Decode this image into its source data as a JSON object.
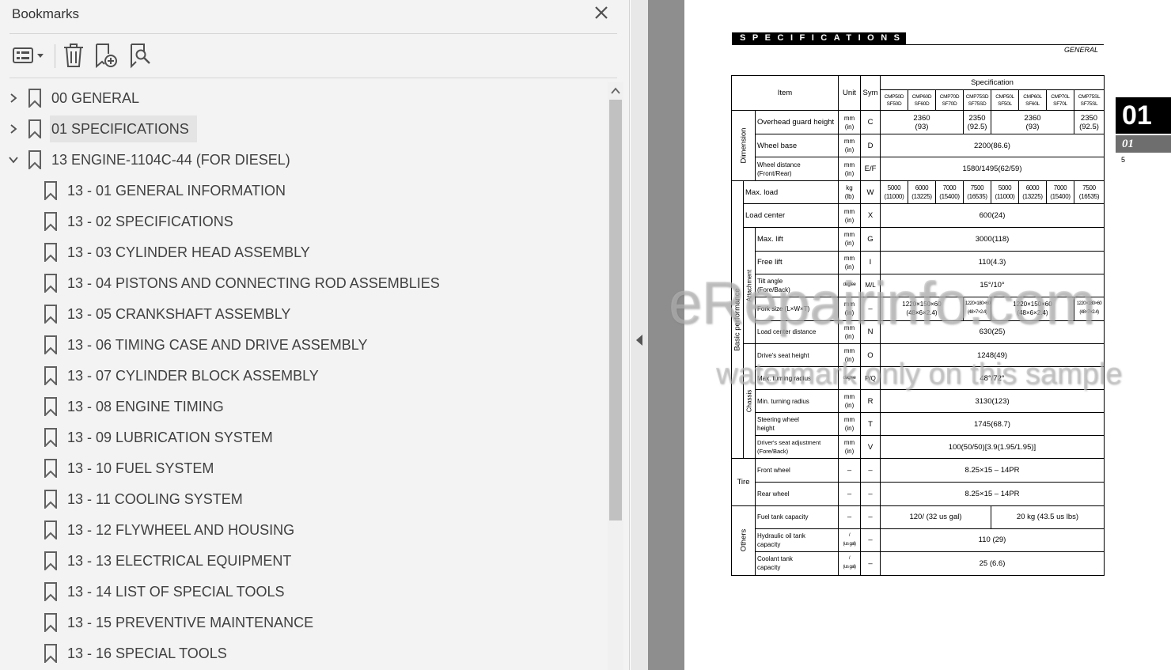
{
  "panel": {
    "title": "Bookmarks",
    "toolbar": [
      {
        "name": "options-menu-button",
        "icon": "list-options-icon"
      },
      {
        "name": "delete-bookmark-button",
        "icon": "trash-icon"
      },
      {
        "name": "new-bookmark-button",
        "icon": "add-bookmark-icon"
      },
      {
        "name": "find-bookmark-button",
        "icon": "search-bookmark-icon"
      }
    ],
    "bookmarks": [
      {
        "label": "00 GENERAL",
        "level": 0,
        "expander": "collapsed",
        "selected": false
      },
      {
        "label": "01 SPECIFICATIONS",
        "level": 0,
        "expander": "collapsed",
        "selected": true
      },
      {
        "label": "13 ENGINE-1104C-44 (FOR DIESEL)",
        "level": 0,
        "expander": "expanded",
        "selected": false
      },
      {
        "label": "13 - 01 GENERAL INFORMATION",
        "level": 1,
        "expander": "none",
        "selected": false
      },
      {
        "label": "13 - 02 SPECIFICATIONS",
        "level": 1,
        "expander": "none",
        "selected": false
      },
      {
        "label": "13 - 03 CYLINDER HEAD ASSEMBLY",
        "level": 1,
        "expander": "none",
        "selected": false
      },
      {
        "label": "13 - 04 PISTONS AND CONNECTING ROD ASSEMBLIES",
        "level": 1,
        "expander": "none",
        "selected": false
      },
      {
        "label": "13 - 05 CRANKSHAFT ASSEMBLY",
        "level": 1,
        "expander": "none",
        "selected": false
      },
      {
        "label": "13 - 06 TIMING CASE AND DRIVE ASSEMBLY",
        "level": 1,
        "expander": "none",
        "selected": false
      },
      {
        "label": "13 - 07 CYLINDER BLOCK ASSEMBLY",
        "level": 1,
        "expander": "none",
        "selected": false
      },
      {
        "label": "13 - 08 ENGINE TIMING",
        "level": 1,
        "expander": "none",
        "selected": false
      },
      {
        "label": "13 - 09 LUBRICATION SYSTEM",
        "level": 1,
        "expander": "none",
        "selected": false
      },
      {
        "label": "13 - 10 FUEL SYSTEM",
        "level": 1,
        "expander": "none",
        "selected": false
      },
      {
        "label": "13 - 11 COOLING SYSTEM",
        "level": 1,
        "expander": "none",
        "selected": false
      },
      {
        "label": "13 - 12 FLYWHEEL AND HOUSING",
        "level": 1,
        "expander": "none",
        "selected": false
      },
      {
        "label": "13 - 13 ELECTRICAL EQUIPMENT",
        "level": 1,
        "expander": "none",
        "selected": false
      },
      {
        "label": "13 - 14 LIST OF SPECIAL TOOLS",
        "level": 1,
        "expander": "none",
        "selected": false
      },
      {
        "label": "13 - 15 PREVENTIVE MAINTENANCE",
        "level": 1,
        "expander": "none",
        "selected": false
      },
      {
        "label": "13 - 16 SPECIAL TOOLS",
        "level": 1,
        "expander": "none",
        "selected": false
      }
    ]
  },
  "document": {
    "header": "SPECIFICATIONS",
    "subheader": "GENERAL",
    "chapter_tab": "01",
    "chapter_tab_small": "01",
    "page_number": "5",
    "watermark_main": "eRepairinfo.com",
    "watermark_sub": "watermark only on this sample",
    "table": {
      "head_item": "Item",
      "head_unit": "Unit",
      "head_sym": "Sym",
      "head_spec": "Specification",
      "models": [
        [
          "CMP50D",
          "SF50D"
        ],
        [
          "CMP60D",
          "SF60D"
        ],
        [
          "CMP70D",
          "SF70D"
        ],
        [
          "CMP75SD",
          "SF75SD"
        ],
        [
          "CMP50L",
          "SF50L"
        ],
        [
          "CMP60L",
          "SF60L"
        ],
        [
          "CMP70L",
          "SF70L"
        ],
        [
          "CMP75SL",
          "SF75SL"
        ]
      ],
      "groups": {
        "dimension": "Dimension",
        "basic": "Basic performance",
        "attachment": "Attachment",
        "chassis": "Chassis",
        "tire": "Tire",
        "others": "Others"
      },
      "rows": {
        "overhead": {
          "item": "Overhead guard height",
          "unit": [
            "mm",
            "(in)"
          ],
          "sym": "C",
          "v1": [
            "2360",
            "(93)"
          ],
          "v2": [
            "2350",
            "(92.5)"
          ],
          "v3": [
            "2360",
            "(93)"
          ],
          "v4": [
            "2350",
            "(92.5)"
          ]
        },
        "wheelbase": {
          "item": "Wheel base",
          "unit": [
            "mm",
            "(in)"
          ],
          "sym": "D",
          "val": "2200(86.6)"
        },
        "wheeldist": {
          "item": [
            "Wheel distance",
            "(Front/Rear)"
          ],
          "unit": [
            "mm",
            "(in)"
          ],
          "sym": "E/F",
          "val": "1580/1495(62/59)"
        },
        "maxload": {
          "item": "Max. load",
          "unit": [
            "kg",
            "(lb)"
          ],
          "sym": "W",
          "vals": [
            [
              "5000",
              "(11000)"
            ],
            [
              "6000",
              "(13225)"
            ],
            [
              "7000",
              "(15400)"
            ],
            [
              "7500",
              "(16535)"
            ],
            [
              "5000",
              "(11000)"
            ],
            [
              "6000",
              "(13225)"
            ],
            [
              "7000",
              "(15400)"
            ],
            [
              "7500",
              "(16535)"
            ]
          ]
        },
        "loadcenter": {
          "item": "Load center",
          "unit": [
            "mm",
            "(in)"
          ],
          "sym": "X",
          "val": "600(24)"
        },
        "maxlift": {
          "item": "Max. lift",
          "unit": [
            "mm",
            "(in)"
          ],
          "sym": "G",
          "val": "3000(118)"
        },
        "freelift": {
          "item": "Free lift",
          "unit": [
            "mm",
            "(in)"
          ],
          "sym": "I",
          "val": "110(4.3)"
        },
        "tilt": {
          "item": [
            "Tilt angle",
            "(Fore/Back)"
          ],
          "unit": "degree",
          "sym": "M/L",
          "val": "15°/10°"
        },
        "forksize": {
          "item": "Fork size (L×W×T)",
          "unit": [
            "mm",
            "(in)"
          ],
          "sym": "–",
          "v1": [
            "1220×150×60",
            "(48×6×2.4)"
          ],
          "v2": [
            "1220×180×60",
            "(48×7×2.4)"
          ],
          "v3": [
            "1220×150×60",
            "(48×6×2.4)"
          ],
          "v4": [
            "1220×180×60",
            "(48×7×2.4)"
          ]
        },
        "lcdist": {
          "item": "Load center distance",
          "unit": [
            "mm",
            "(in)"
          ],
          "sym": "N",
          "val": "630(25)"
        },
        "seatheight": {
          "item": "Drive's seat height",
          "unit": [
            "mm",
            "(in)"
          ],
          "sym": "O",
          "val": "1248(49)"
        },
        "maxturn": {
          "item": "Max. turning radius",
          "unit": "degree",
          "sym": "P/Q",
          "val": "48°/72°"
        },
        "minturn": {
          "item": "Min. turning radius",
          "unit": [
            "mm",
            "(in)"
          ],
          "sym": "R",
          "val": "3130(123)"
        },
        "steering": {
          "item": [
            "Steering wheel",
            "height"
          ],
          "unit": [
            "mm",
            "(in)"
          ],
          "sym": "T",
          "val": "1745(68.7)"
        },
        "seatadj": {
          "item": [
            "Driver's seat adjustment",
            "(Fore/Back)"
          ],
          "unit": [
            "mm",
            "(in)"
          ],
          "sym": "V",
          "val": "100(50/50)[3.9(1.95/1.95)]"
        },
        "frontwheel": {
          "item": "Front wheel",
          "unit": "–",
          "sym": "–",
          "val": "8.25×15 – 14PR"
        },
        "rearwheel": {
          "item": "Rear wheel",
          "unit": "–",
          "sym": "–",
          "val": "8.25×15 – 14PR"
        },
        "fuel": {
          "item": "Fuel tank capacity",
          "unit": "–",
          "sym": "–",
          "v1": "120/ (32 us gal)",
          "v2": "20 kg (43.5 us lbs)"
        },
        "hydraulic": {
          "item": [
            "Hydraulic oil tank",
            "capacity"
          ],
          "unit": [
            "/",
            "(us gal)"
          ],
          "sym": "–",
          "val": "110 (29)"
        },
        "coolant": {
          "item": [
            "Coolant tank",
            "capacity"
          ],
          "unit": [
            "/",
            "(us gal)"
          ],
          "sym": "–",
          "val": "25 (6.6)"
        }
      }
    }
  }
}
